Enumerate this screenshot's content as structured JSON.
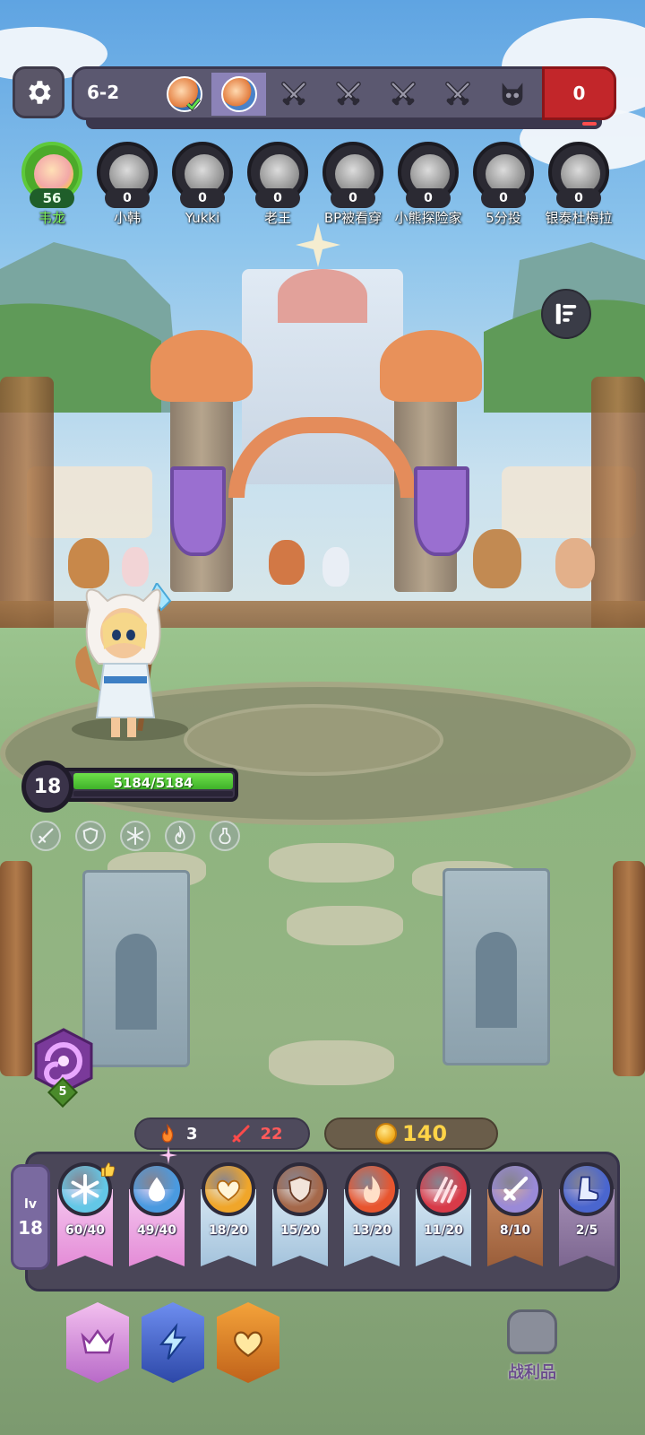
{
  "stage": {
    "label": "6-2",
    "score": "0",
    "icons": [
      "portrait-cleared-icon",
      "portrait-current-icon",
      "crossed-swords-icon",
      "crossed-swords-icon",
      "crossed-swords-icon",
      "crossed-swords-icon",
      "boss-skull-icon"
    ]
  },
  "players": [
    {
      "name": "韦龙",
      "score": "56",
      "me": true
    },
    {
      "name": "小韩",
      "score": "0"
    },
    {
      "name": "Yukki",
      "score": "0"
    },
    {
      "name": "老王",
      "score": "0"
    },
    {
      "name": "BP被看穿",
      "score": "0"
    },
    {
      "name": "小熊探险家",
      "score": "0"
    },
    {
      "name": "5分投",
      "score": "0"
    },
    {
      "name": "银泰杜梅拉",
      "score": "0"
    }
  ],
  "hero": {
    "level": "18",
    "hp": "5184/5184",
    "hp_fraction": 1.0,
    "status_icons": [
      "sword-icon",
      "shield-icon",
      "snowflake-icon",
      "flame-icon",
      "potion-icon"
    ]
  },
  "swirl": {
    "count": "5"
  },
  "resources": {
    "fire": "3",
    "attack": "22",
    "gold": "140"
  },
  "level_box": {
    "label": "lv",
    "value": "18"
  },
  "cards": [
    {
      "icon": "snowflake-icon",
      "count": "60/40",
      "ribbon": "pink",
      "color": "#63c7e6"
    },
    {
      "icon": "water-drop-icon",
      "count": "49/40",
      "ribbon": "pink",
      "color": "#4a9ae0"
    },
    {
      "icon": "heart-icon",
      "count": "18/20",
      "ribbon": "blue",
      "color": "#f0a62a"
    },
    {
      "icon": "shield-icon",
      "count": "15/20",
      "ribbon": "blue",
      "color": "#a5684a"
    },
    {
      "icon": "flame-icon",
      "count": "13/20",
      "ribbon": "blue",
      "color": "#e8552e"
    },
    {
      "icon": "claw-slash-icon",
      "count": "11/20",
      "ribbon": "blue",
      "color": "#d83a48"
    },
    {
      "icon": "sword-icon",
      "count": "8/10",
      "ribbon": "brown",
      "color": "#9a8ad8"
    },
    {
      "icon": "boot-icon",
      "count": "2/5",
      "ribbon": "violet",
      "color": "#4a66cf"
    }
  ],
  "bottom_buttons": [
    "crown-icon",
    "lightning-icon",
    "heart-swirl-icon"
  ],
  "loot": {
    "label": "战利品"
  }
}
